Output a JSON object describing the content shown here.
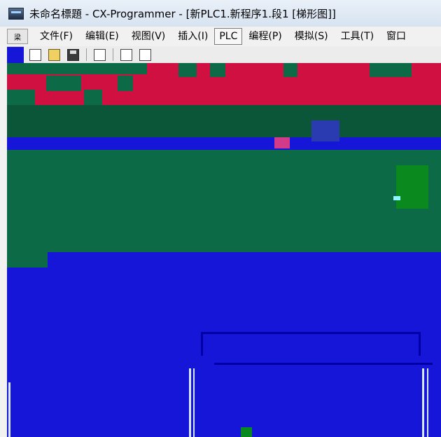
{
  "window": {
    "title": "未命名標題 - CX-Programmer - [新PLC1.新程序1.段1 [梯形图]]"
  },
  "menubar": {
    "system_menu_label": "梁",
    "items": [
      {
        "label": "文件(F)"
      },
      {
        "label": "编辑(E)"
      },
      {
        "label": "视图(V)"
      },
      {
        "label": "插入(I)"
      },
      {
        "label": "PLC"
      },
      {
        "label": "编程(P)"
      },
      {
        "label": "模拟(S)"
      },
      {
        "label": "工具(T)"
      },
      {
        "label": "窗口"
      }
    ],
    "active_item": "PLC"
  },
  "toolbar": {
    "buttons": [
      {
        "icon": "new-file-icon"
      },
      {
        "icon": "open-folder-icon"
      },
      {
        "icon": "save-icon"
      },
      {
        "icon": "copy-icon"
      },
      {
        "icon": "print-icon"
      },
      {
        "icon": "print-preview-icon"
      }
    ]
  },
  "colors": {
    "workspace_blue": "#1616d8",
    "workspace_green": "#0c6a46",
    "workspace_red": "#d01040",
    "bright_green": "#0a8a1e"
  }
}
